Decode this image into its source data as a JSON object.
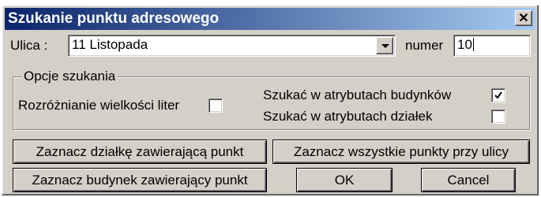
{
  "window": {
    "title": "Szukanie punktu adresowego",
    "close_glyph": "✕"
  },
  "street": {
    "label": "Ulica :",
    "value": "11 Listopada"
  },
  "number": {
    "label": "numer",
    "value": "10"
  },
  "options": {
    "legend": "Opcje szukania",
    "case_sensitive": {
      "label": "Rozróżnianie wielkości liter",
      "checked": false
    },
    "building_attrs": {
      "label": "Szukać w atrybutach budynków",
      "checked": true
    },
    "parcel_attrs": {
      "label": "Szukać w atrybutach działek",
      "checked": false
    }
  },
  "buttons": {
    "select_parcel": "Zaznacz działkę zawierającą punkt",
    "select_all_points": "Zaznacz wszystkie punkty przy ulicy",
    "select_building": "Zaznacz budynek zawierający punkt",
    "ok": "OK",
    "cancel": "Cancel"
  }
}
